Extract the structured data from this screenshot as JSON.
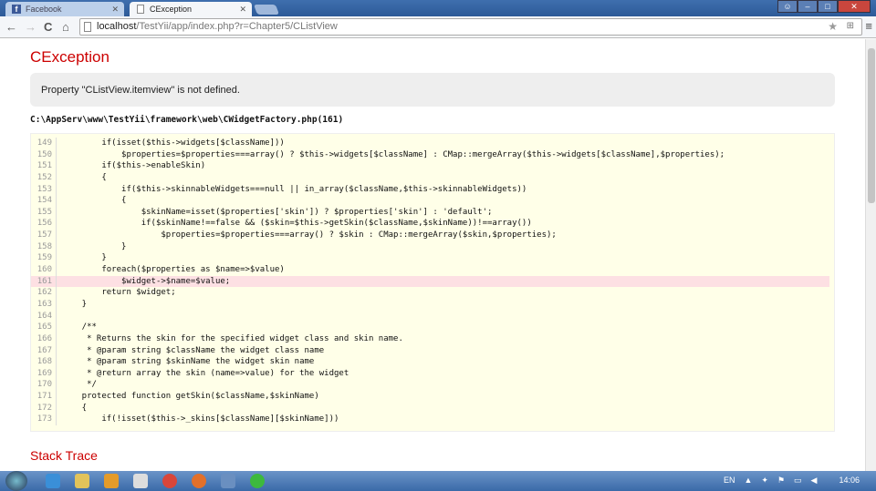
{
  "browser": {
    "tabs": [
      {
        "label": "Facebook",
        "icon": "facebook-icon"
      },
      {
        "label": "CException",
        "icon": "page-icon"
      }
    ],
    "url_host": "localhost",
    "url_path": "/TestYii/app/index.php?r=Chapter5/CListView"
  },
  "page": {
    "title": "CException",
    "message": "Property \"CListView.itemview\" is not defined.",
    "file": "C:\\AppServ\\www\\TestYii\\framework\\web\\CWidgetFactory.php(161)",
    "error_line": "161",
    "code_lines": [
      {
        "num": "149",
        "code": "        if(isset($this->widgets[$className]))"
      },
      {
        "num": "150",
        "code": "            $properties=$properties===array() ? $this->widgets[$className] : CMap::mergeArray($this->widgets[$className],$properties);"
      },
      {
        "num": "151",
        "code": "        if($this->enableSkin)"
      },
      {
        "num": "152",
        "code": "        {"
      },
      {
        "num": "153",
        "code": "            if($this->skinnableWidgets===null || in_array($className,$this->skinnableWidgets))"
      },
      {
        "num": "154",
        "code": "            {"
      },
      {
        "num": "155",
        "code": "                $skinName=isset($properties['skin']) ? $properties['skin'] : 'default';"
      },
      {
        "num": "156",
        "code": "                if($skinName!==false && ($skin=$this->getSkin($className,$skinName))!==array())"
      },
      {
        "num": "157",
        "code": "                    $properties=$properties===array() ? $skin : CMap::mergeArray($skin,$properties);"
      },
      {
        "num": "158",
        "code": "            }"
      },
      {
        "num": "159",
        "code": "        }"
      },
      {
        "num": "160",
        "code": "        foreach($properties as $name=>$value)"
      },
      {
        "num": "161",
        "code": "            $widget->$name=$value;"
      },
      {
        "num": "162",
        "code": "        return $widget;"
      },
      {
        "num": "163",
        "code": "    }"
      },
      {
        "num": "164",
        "code": ""
      },
      {
        "num": "165",
        "code": "    /**"
      },
      {
        "num": "166",
        "code": "     * Returns the skin for the specified widget class and skin name."
      },
      {
        "num": "167",
        "code": "     * @param string $className the widget class name"
      },
      {
        "num": "168",
        "code": "     * @param string $skinName the widget skin name"
      },
      {
        "num": "169",
        "code": "     * @return array the skin (name=>value) for the widget"
      },
      {
        "num": "170",
        "code": "     */"
      },
      {
        "num": "171",
        "code": "    protected function getSkin($className,$skinName)"
      },
      {
        "num": "172",
        "code": "    {"
      },
      {
        "num": "173",
        "code": "        if(!isset($this->_skins[$className][$skinName]))"
      }
    ],
    "stack_trace_title": "Stack Trace"
  },
  "taskbar": {
    "lang": "EN",
    "clock": "14:06"
  }
}
